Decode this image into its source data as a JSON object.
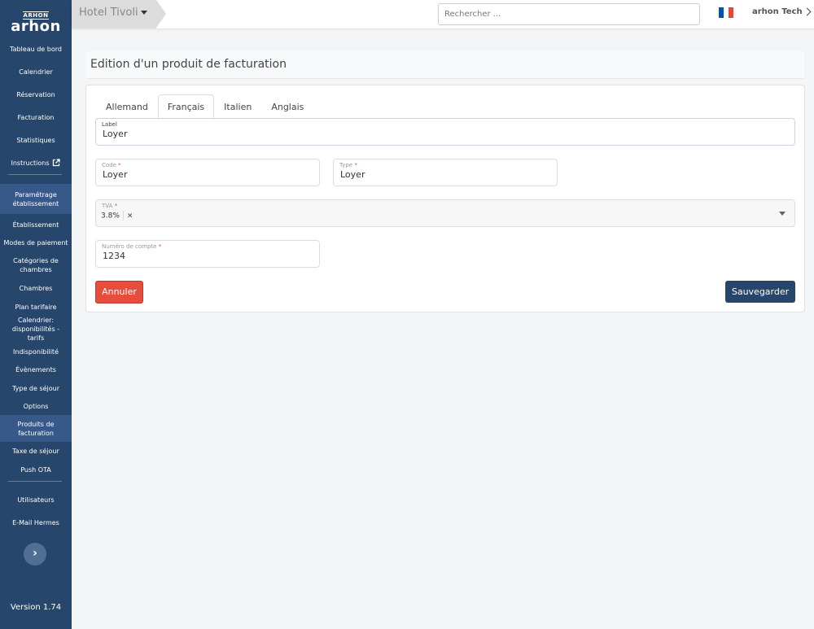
{
  "brand": {
    "logo_top": "ARHON",
    "logo_main": "arhon",
    "version": "Version 1.74"
  },
  "sidebar": {
    "items": [
      {
        "label": "Tableau de bord"
      },
      {
        "label": "Calendrier"
      },
      {
        "label": "Réservation"
      },
      {
        "label": "Facturation"
      },
      {
        "label": "Statistiques"
      },
      {
        "label": "Instructions"
      },
      {
        "label": "Paramétrage établissement"
      },
      {
        "label": "Établissement"
      },
      {
        "label": "Modes de paiement"
      },
      {
        "label": "Catégories de chambres"
      },
      {
        "label": "Chambres"
      },
      {
        "label": "Plan tarifaire"
      },
      {
        "label": "Calendrier: disponibilités - tarifs"
      },
      {
        "label": "Indisponibilité"
      },
      {
        "label": "Évènements"
      },
      {
        "label": "Type de séjour"
      },
      {
        "label": "Options"
      },
      {
        "label": "Produits de facturation"
      },
      {
        "label": "Taxe de séjour"
      },
      {
        "label": "Push OTA"
      },
      {
        "label": "Utilisateurs"
      },
      {
        "label": "E-Mail Hermes"
      }
    ],
    "collapse_glyph": "›"
  },
  "topbar": {
    "hotel": "Hotel Tivoli",
    "search_placeholder": "Rechercher ...",
    "user": "arhon Tech",
    "flag_colors": [
      "#0055a4",
      "#ffffff",
      "#ef4135"
    ]
  },
  "page": {
    "title": "Edition d'un produit de facturation"
  },
  "tabs": [
    {
      "label": "Allemand"
    },
    {
      "label": "Français"
    },
    {
      "label": "Italien"
    },
    {
      "label": "Anglais"
    }
  ],
  "active_tab": "Français",
  "form": {
    "label": {
      "label": "Label",
      "value": "Loyer"
    },
    "code": {
      "label": "Code",
      "value": "Loyer"
    },
    "type": {
      "label": "Type",
      "value": "Loyer"
    },
    "tva": {
      "label": "TVA",
      "value": "3.8%",
      "remove": "×"
    },
    "account": {
      "label": "Numéro de compte",
      "value": "1234"
    },
    "required_mark": "*"
  },
  "buttons": {
    "cancel": "Annuler",
    "save": "Sauvegarder"
  },
  "colors": {
    "sidebar": "#26466b",
    "cancel": "#e74c3c",
    "save": "#26466b"
  }
}
